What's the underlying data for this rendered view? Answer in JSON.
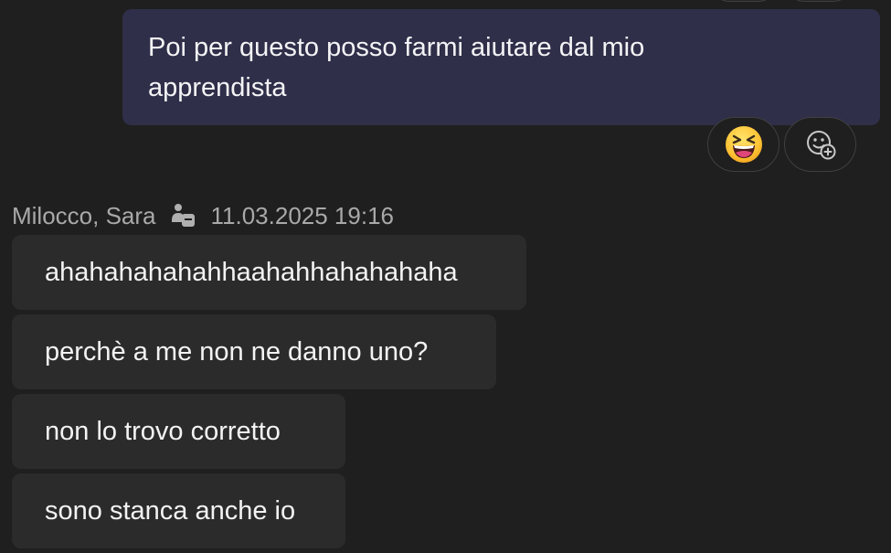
{
  "sent_message": {
    "text": "Poi per questo posso farmi aiutare dal mio apprendista"
  },
  "reactions": [
    {
      "icon": "grinning-squinting-face-icon",
      "interactable": true
    },
    {
      "icon": "add-reaction-icon",
      "interactable": true
    }
  ],
  "received": {
    "sender_name": "Milocco, Sara",
    "sender_status_icon": "away-status-icon",
    "timestamp": "11.03.2025 19:16",
    "messages": [
      "ahahahahahahhaahahhahahahaha",
      "perchè a me non ne danno uno?",
      "non lo trovo corretto",
      "sono stanca anche io"
    ]
  },
  "colors": {
    "background": "#1f1f1f",
    "sent_bubble": "#2f2f4a",
    "received_bubble": "#2b2b2b",
    "meta_text": "#a9a9a9"
  }
}
